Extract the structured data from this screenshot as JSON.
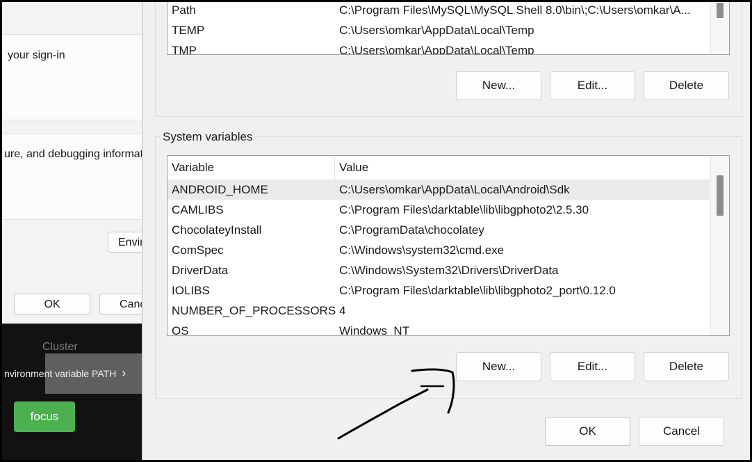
{
  "background_dialog": {
    "sign_in_text": "your sign-in",
    "debug_text": "ure, and debugging informat",
    "env_button_label": "Enviro",
    "ok_label": "OK",
    "cancel_label": "Canc"
  },
  "background_app": {
    "cluster_text": "Cluster",
    "env_path_link": "nvironment variable PATH",
    "chevron": "›",
    "focus_label": "focus"
  },
  "user_variables": {
    "rows": [
      {
        "variable": "Path",
        "value": "C:\\Program Files\\MySQL\\MySQL Shell 8.0\\bin\\;C:\\Users\\omkar\\A..."
      },
      {
        "variable": "TEMP",
        "value": "C:\\Users\\omkar\\AppData\\Local\\Temp"
      },
      {
        "variable": "TMP",
        "value": "C:\\Users\\omkar\\AppData\\Local\\Temp"
      }
    ],
    "buttons": {
      "new": "New...",
      "edit": "Edit...",
      "delete": "Delete"
    }
  },
  "system_variables": {
    "title": "System variables",
    "header": {
      "variable": "Variable",
      "value": "Value"
    },
    "rows": [
      {
        "variable": "ANDROID_HOME",
        "value": "C:\\Users\\omkar\\AppData\\Local\\Android\\Sdk"
      },
      {
        "variable": "CAMLIBS",
        "value": "C:\\Program Files\\darktable\\lib\\libgphoto2\\2.5.30"
      },
      {
        "variable": "ChocolateyInstall",
        "value": "C:\\ProgramData\\chocolatey"
      },
      {
        "variable": "ComSpec",
        "value": "C:\\Windows\\system32\\cmd.exe"
      },
      {
        "variable": "DriverData",
        "value": "C:\\Windows\\System32\\Drivers\\DriverData"
      },
      {
        "variable": "IOLIBS",
        "value": "C:\\Program Files\\darktable\\lib\\libgphoto2_port\\0.12.0"
      },
      {
        "variable": "NUMBER_OF_PROCESSORS",
        "value": "4"
      },
      {
        "variable": "OS",
        "value": "Windows_NT"
      }
    ],
    "selected_index": 0,
    "buttons": {
      "new": "New...",
      "edit": "Edit...",
      "delete": "Delete"
    }
  },
  "dialog_buttons": {
    "ok": "OK",
    "cancel": "Cancel"
  },
  "colors": {
    "focus_button": "#4caf50",
    "selected_row": "#eaeaea"
  }
}
